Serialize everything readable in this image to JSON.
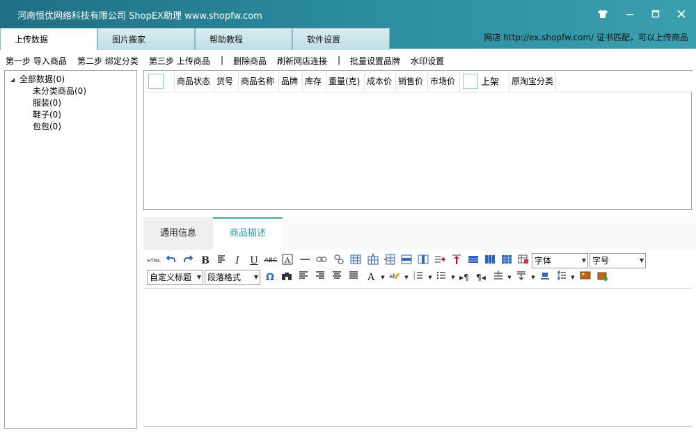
{
  "window": {
    "title": "河南恒优网络科技有限公司 ShopEX助理 www.shopfw.com"
  },
  "tabs": [
    {
      "label": "上传数据",
      "active": true
    },
    {
      "label": "图片搬家",
      "active": false
    },
    {
      "label": "帮助教程",
      "active": false
    },
    {
      "label": "软件设置",
      "active": false
    }
  ],
  "shop_info": "网店 http://ex.shopfw.com/ 证书匹配，可以上传商品",
  "toolbar": {
    "step1": "第一步 导入商品",
    "step2": "第二步 绑定分类",
    "step3": "第三步 上传商品",
    "sep": "|",
    "delete": "删除商品",
    "refresh": "刷新网店连接",
    "batch_brand": "批量设置品牌",
    "watermark": "水印设置"
  },
  "tree": {
    "root": "全部数据(0)",
    "children": [
      "未分类商品(0)",
      "服装(0)",
      "鞋子(0)",
      "包包(0)"
    ]
  },
  "grid": {
    "columns": [
      "商品状态",
      "货号",
      "商品名称",
      "品牌",
      "库存",
      "重量(克)",
      "成本价",
      "销售价",
      "市场价",
      "上架",
      "原淘宝分类"
    ]
  },
  "bottom_tabs": [
    {
      "label": "通用信息",
      "active": false
    },
    {
      "label": "商品描述",
      "active": true
    }
  ],
  "editor": {
    "font_select": "字体",
    "size_select": "字号",
    "heading_select": "自定义标题",
    "format_select": "段落格式",
    "html_label": "HTML"
  },
  "colors": {
    "titlebar": "#2d8ea0",
    "accent": "#3a9aa8"
  }
}
